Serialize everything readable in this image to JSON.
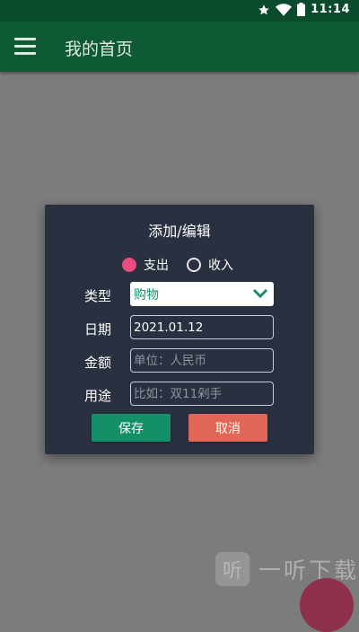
{
  "status_bar": {
    "time": "11:14",
    "icons": [
      "star-icon",
      "wifi-icon",
      "battery-icon"
    ]
  },
  "app_bar": {
    "title": "我的首页",
    "menu_icon": "hamburger-menu-icon"
  },
  "dialog": {
    "title": "添加/编辑",
    "radio_options": [
      {
        "label": "支出",
        "selected": true
      },
      {
        "label": "收入",
        "selected": false
      }
    ],
    "fields": {
      "type": {
        "label": "类型",
        "value": "购物"
      },
      "date": {
        "label": "日期",
        "value": "2021.01.12"
      },
      "amount": {
        "label": "金额",
        "placeholder": "单位：人民币",
        "value": ""
      },
      "purpose": {
        "label": "用途",
        "placeholder": "比如：双11剁手",
        "value": ""
      }
    },
    "save_label": "保存",
    "cancel_label": "取消"
  },
  "watermark": {
    "logo_glyph": "听",
    "text": "一听下载"
  },
  "colors": {
    "status_bar": "#0b4b2d",
    "app_bar": "#0e5a35",
    "dialog_bg": "#29303f",
    "radio_selected": "#e94c7e",
    "accent_green": "#139068",
    "cancel_red": "#e06655"
  }
}
